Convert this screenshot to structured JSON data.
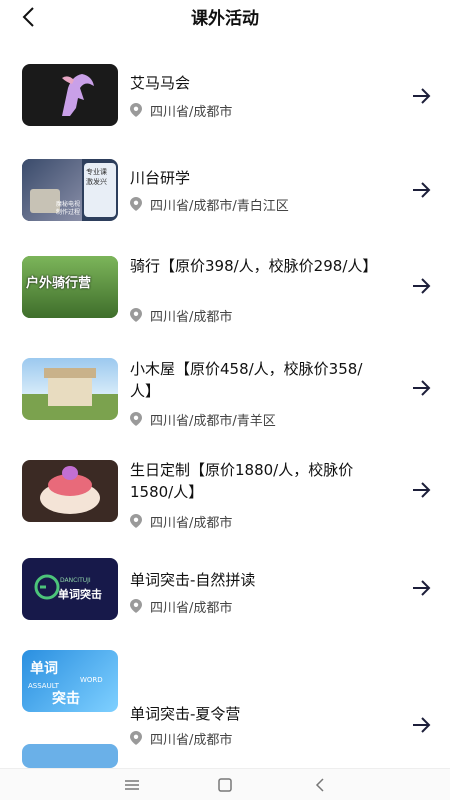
{
  "header": {
    "title": "课外活动"
  },
  "items": [
    {
      "title": "艾马马会",
      "location": "四川省/成都市"
    },
    {
      "title": "川台研学",
      "location": "四川省/成都市/青白江区",
      "thumb_text": [
        "专业课",
        "激发兴",
        "魔秘电视",
        "制作过程"
      ]
    },
    {
      "title": "骑行【原价398/人，校脉价298/人】",
      "location": "四川省/成都市",
      "thumb_text": "户外骑行营"
    },
    {
      "title": "小木屋【原价458/人，校脉价358/人】",
      "location": "四川省/成都市/青羊区"
    },
    {
      "title": "生日定制【原价1880/人，校脉价1580/人】",
      "location": "四川省/成都市"
    },
    {
      "title": "单词突击-自然拼读",
      "location": "四川省/成都市",
      "thumb_text": [
        "DANCITUJI",
        "单词突击"
      ]
    },
    {
      "title": "单词突击-夏令营",
      "location": "四川省/成都市",
      "thumb_text": [
        "单词",
        "WORD",
        "ASSAULT",
        "突击"
      ]
    },
    {
      "title": "",
      "location": ""
    }
  ],
  "colors": {
    "accent": "#1d1f3a",
    "text": "#111111",
    "muted": "#444444"
  }
}
